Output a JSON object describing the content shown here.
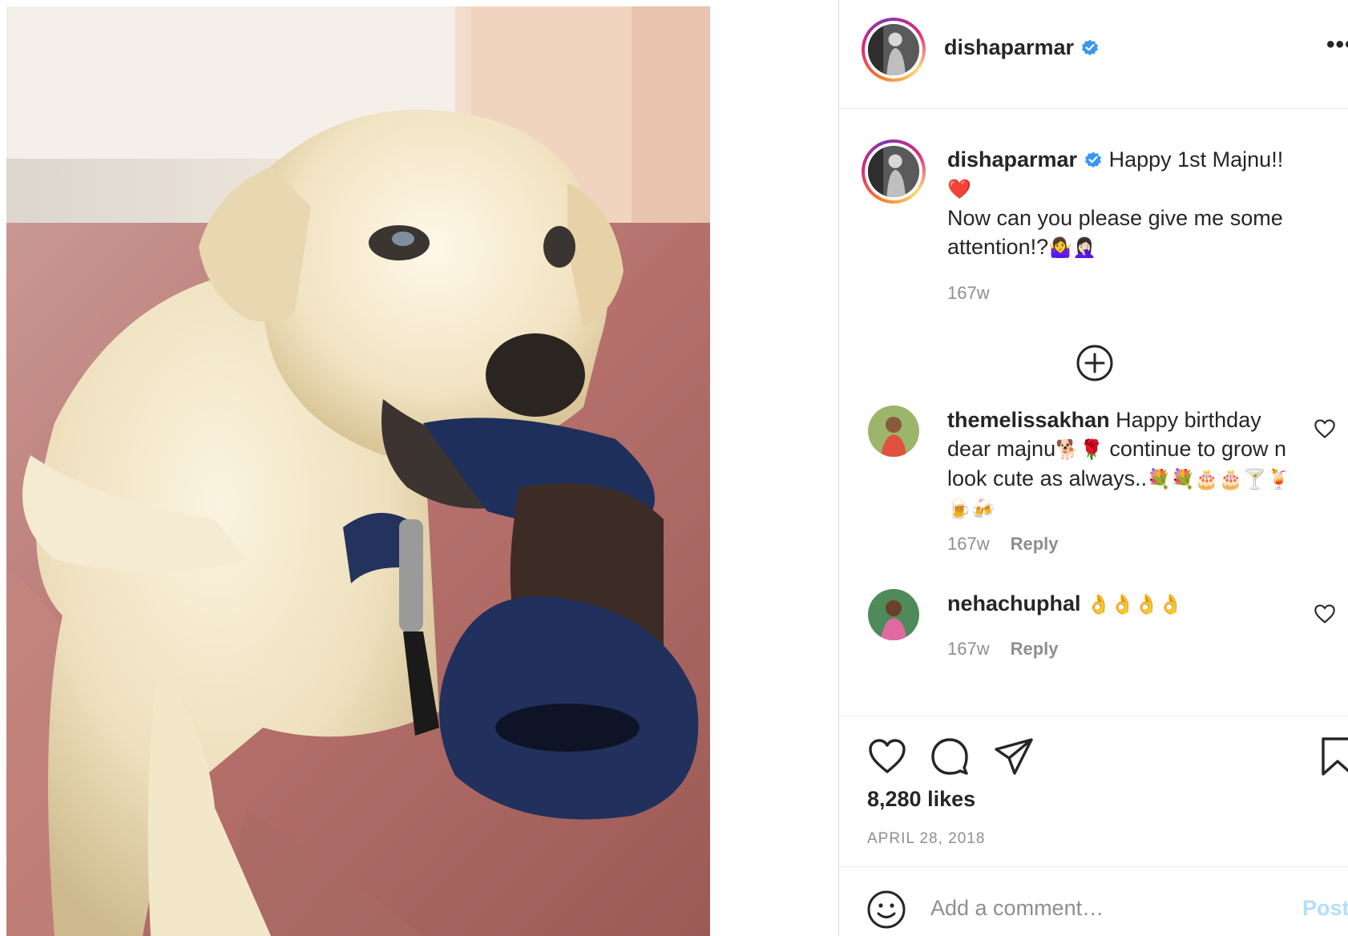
{
  "post": {
    "username": "dishaparmar",
    "more_label": "•••"
  },
  "caption": {
    "username": "dishaparmar",
    "line1": "Happy 1st Majnu!!",
    "heart": "❤️",
    "line2": "Now can you please give me some attention!?",
    "line2_emoji": "🤷‍♀️🤦🏻‍♀️",
    "time": "167w"
  },
  "comments": [
    {
      "username": "themelissakhan",
      "text": "Happy birthday dear majnu",
      "emoji1": "🐕🌹",
      "text2": "continue to grow n look cute as always..",
      "emoji2": "💐💐🎂🎂🍸🍹🍺🍻",
      "time": "167w",
      "reply": "Reply"
    },
    {
      "username": "nehachuphal",
      "emoji": "👌👌👌👌",
      "time": "167w",
      "reply": "Reply"
    }
  ],
  "likes": "8,280 likes",
  "date": "APRIL 28, 2018",
  "add_comment": {
    "placeholder": "Add a comment…",
    "post_label": "Post"
  },
  "icons": {
    "like": "heart-icon",
    "comment": "comment-icon",
    "share": "share-icon",
    "save": "bookmark-icon",
    "emoji": "emoji-icon",
    "verified": "verified-badge-icon",
    "load_more": "plus-circle-icon"
  },
  "colors": {
    "verified": "#3897f0",
    "post_button": "#b2dffc",
    "muted": "#8e8e8e"
  }
}
